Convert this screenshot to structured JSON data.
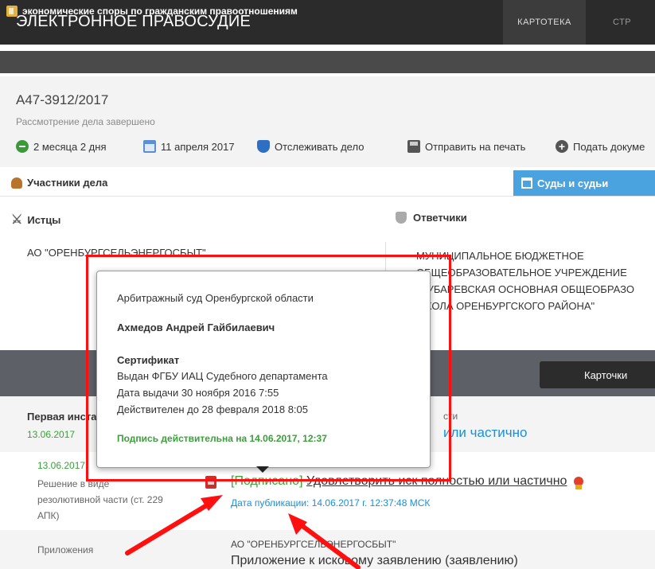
{
  "app": {
    "title": "ЭЛЕКТРОННОЕ ПРАВОСУДИЕ",
    "nav": [
      "КАРТОТЕКА",
      "СТР"
    ]
  },
  "category": "экономические споры по гражданским правоотношениям",
  "case": {
    "number": "А47-3912/2017",
    "status": "Рассмотрение дела завершено",
    "toolbar": {
      "duration": "2 месяца 2 дня",
      "date": "11 апреля 2017",
      "track": "Отслеживать дело",
      "print": "Отправить на печать",
      "submit": "Подать докуме"
    }
  },
  "tabs": {
    "participants": "Участники дела",
    "courts": "Суды и судьи"
  },
  "parties": {
    "plaintiffs_label": "Истцы",
    "defendants_label": "Ответчики",
    "plaintiff": "АО \"ОРЕНБУРГСЕЛЬЭНЕРГОСБЫТ\"",
    "defendant_lines": [
      "МУНИЦИПАЛЬНОЕ БЮДЖЕТНОЕ",
      "ОБЩЕОБРАЗОВАТЕЛЬНОЕ УЧРЕЖДЕНИЕ",
      "\"ДУБАРЕВСКАЯ ОСНОВНАЯ ОБЩЕОБРАЗО",
      "ШКОЛА ОРЕНБУРГСКОГО РАЙОНА\""
    ]
  },
  "cards_button": "Карточки",
  "instance": {
    "label": "Первая инста",
    "date": "13.06.2017",
    "col2_label": "сти",
    "result": "или частично"
  },
  "decision": {
    "date": "13.06.2017",
    "type_lines": [
      "Решение в виде",
      "резолютивной части (ст. 229",
      "АПК)"
    ],
    "signed": "[Подписано]",
    "text": "Удовлетворить иск полностью или частично",
    "published": "Дата публикации: 14.06.2017 г. 12:37:48 МСК"
  },
  "attachments": {
    "label": "Приложения",
    "org": "АО \"ОРЕНБУРГСЕЛЬЭНЕРГОСБЫТ\"",
    "text": "Приложение к исковому заявлению (заявлению)"
  },
  "signature_popup": {
    "court": "Арбитражный суд Оренбургской области",
    "judge": "Ахмедов Андрей Гайбилаевич",
    "cert_label": "Сертификат",
    "issuer": "Выдан ФГБУ ИАЦ Судебного департамента",
    "issued": "Дата выдачи 30 ноября 2016 7:55",
    "valid_until": "Действителен до 28 февраля 2018 8:05",
    "validity": "Подпись действительна на 14.06.2017, 12:37"
  },
  "colors": {
    "topbar": "#2b2b2b",
    "accent_blue": "#4aa3df",
    "green": "#3aa03a",
    "annotation_red": "#ff1010"
  }
}
